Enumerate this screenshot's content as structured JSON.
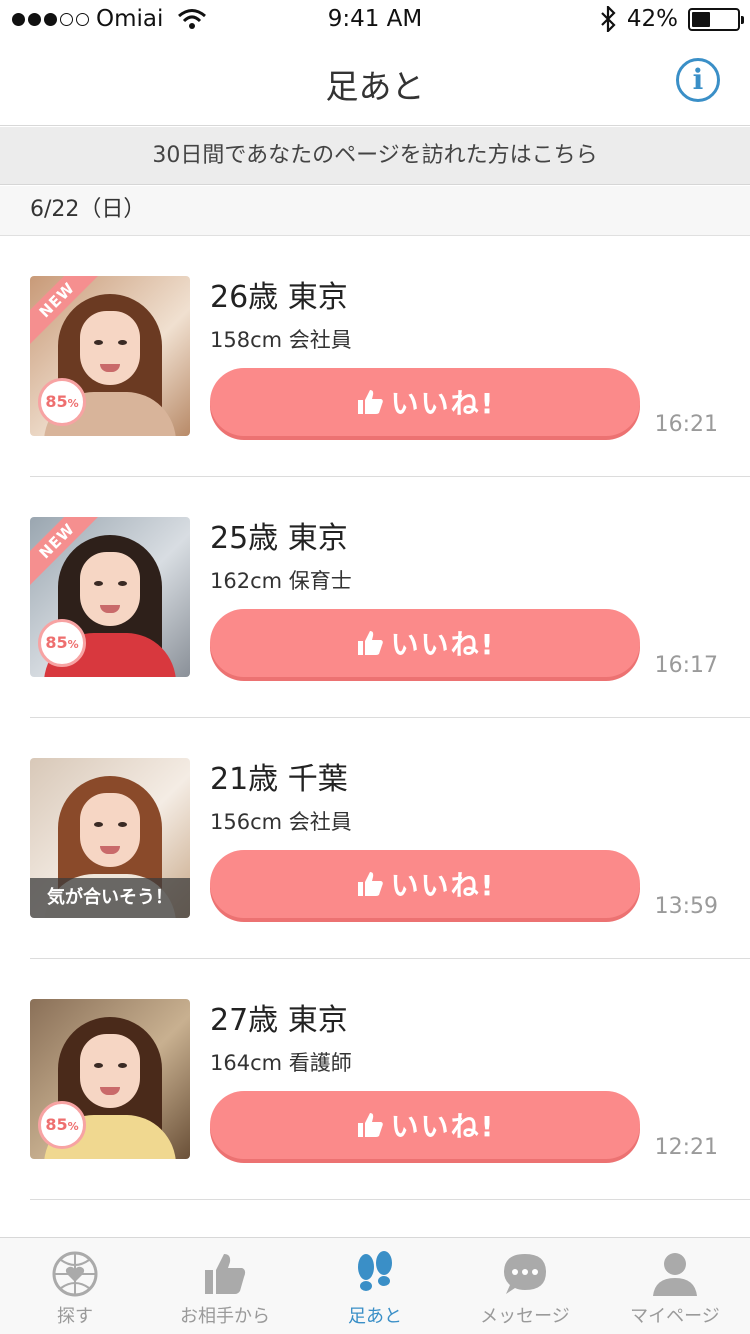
{
  "status": {
    "carrier": "Omiai",
    "time": "9:41 AM",
    "battery": "42%"
  },
  "nav": {
    "title": "足あと",
    "info_icon": "info-icon"
  },
  "notice": "30日間であなたのページを訪れた方はこちら",
  "date_header": "6/22（日）",
  "like_label": "いいね!",
  "items": [
    {
      "age_loc": "26歳 東京",
      "sub": "158cm 会社員",
      "time": "16:21",
      "new_badge": "NEW",
      "match": "85",
      "pct": "%"
    },
    {
      "age_loc": "25歳 東京",
      "sub": "162cm 保育士",
      "time": "16:17",
      "new_badge": "NEW",
      "match": "85",
      "pct": "%"
    },
    {
      "age_loc": "21歳 千葉",
      "sub": "156cm 会社員",
      "time": "13:59",
      "compat": "気が合いそう！"
    },
    {
      "age_loc": "27歳 東京",
      "sub": "164cm 看護師",
      "time": "12:21",
      "match": "85",
      "pct": "%"
    }
  ],
  "tabs": [
    {
      "label": "探す",
      "icon": "globe-heart-icon"
    },
    {
      "label": "お相手から",
      "icon": "thumbs-up-icon"
    },
    {
      "label": "足あと",
      "icon": "footprints-icon",
      "active": true
    },
    {
      "label": "メッセージ",
      "icon": "chat-bubble-icon"
    },
    {
      "label": "マイページ",
      "icon": "person-icon"
    }
  ],
  "colors": {
    "accent": "#3a8fc7",
    "like": "#fb8a8a",
    "match_ring": "#f7a3a3"
  }
}
